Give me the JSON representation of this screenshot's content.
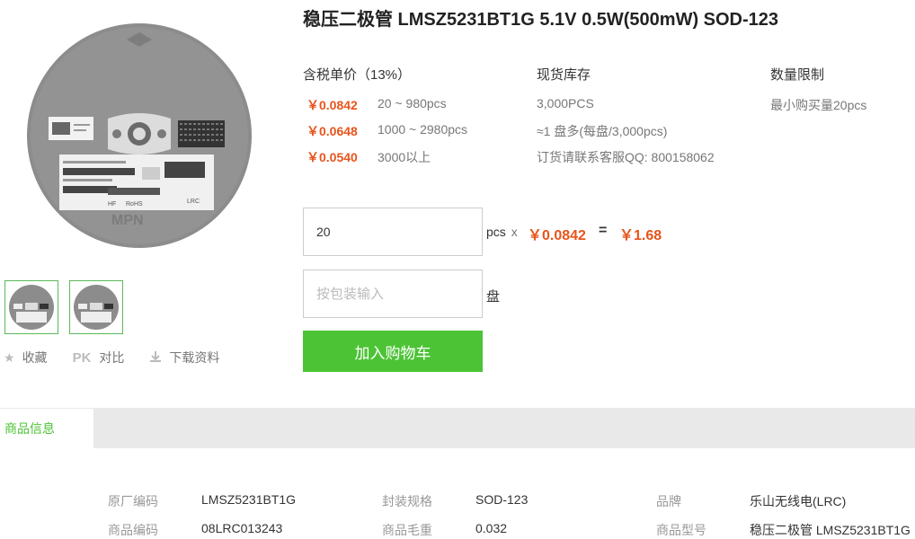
{
  "product": {
    "title": "稳压二极管 LMSZ5231BT1G 5.1V 0.5W(500mW) SOD-123"
  },
  "image": {
    "reel_brand": "MPN",
    "reel_code": "LRC",
    "reel_label_part": "LMSZ5231BT1G",
    "reel_label_rohs": "RoHS",
    "reel_label_hf": "HF"
  },
  "actions": {
    "favorite": "收藏",
    "compare_prefix": "PK",
    "compare": "对比",
    "download": "下载资料"
  },
  "columns": {
    "price_header": "含税单价（13%）",
    "stock_header": "现货库存",
    "limit_header": "数量限制"
  },
  "price_tiers": [
    {
      "price": "￥0.0842",
      "range": "20 ~ 980pcs"
    },
    {
      "price": "￥0.0648",
      "range": "1000 ~ 2980pcs"
    },
    {
      "price": "￥0.0540",
      "range": "3000以上"
    }
  ],
  "stock": {
    "quantity": "3,000PCS",
    "reels": "≈1 盘多(每盘/3,000pcs)",
    "contact": "订货请联系客服QQ: 800158062"
  },
  "limit": {
    "min_order": "最小购买量20pcs"
  },
  "order": {
    "qty_value": "20",
    "qty_unit": "pcs",
    "times": "x",
    "unit_price": "￥0.0842",
    "equals": "=",
    "total": "￥1.68",
    "pkg_placeholder": "按包装输入",
    "pkg_unit": "盘",
    "add_to_cart": "加入购物车"
  },
  "tabs": {
    "product_info": "商品信息"
  },
  "specs": [
    {
      "label": "原厂编码",
      "value": "LMSZ5231BT1G"
    },
    {
      "label": "封装规格",
      "value": "SOD-123"
    },
    {
      "label": "品牌",
      "value": "乐山无线电(LRC)"
    },
    {
      "label": "商品编码",
      "value": "08LRC013243"
    },
    {
      "label": "商品毛重",
      "value": "0.032"
    },
    {
      "label": "商品型号",
      "value": "稳压二极管 LMSZ5231BT1G"
    }
  ]
}
